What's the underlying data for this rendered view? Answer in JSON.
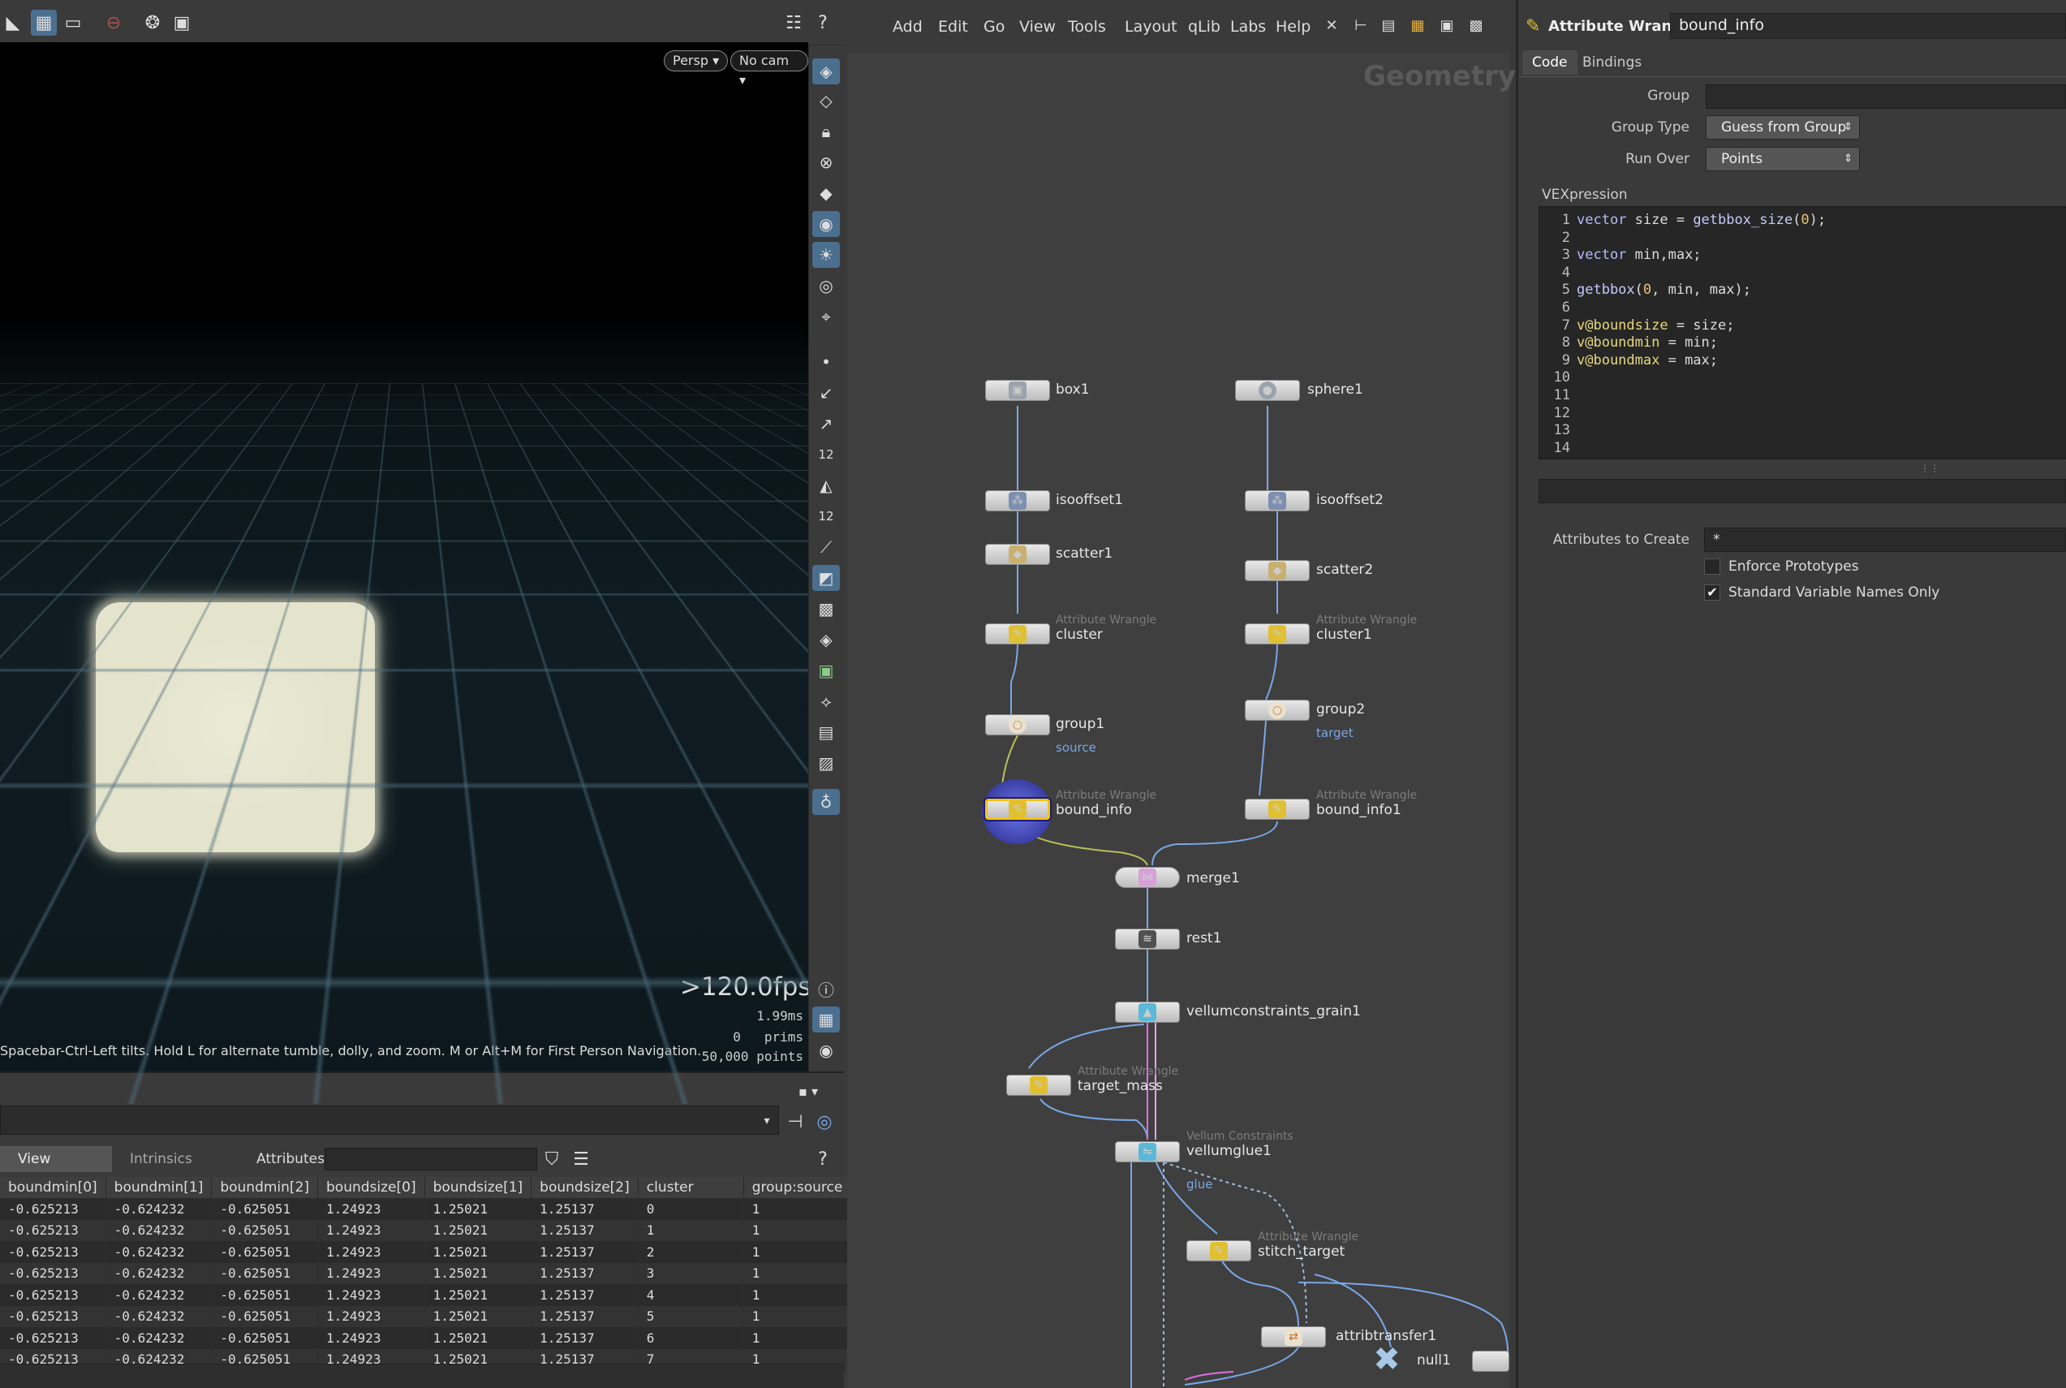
{
  "viewport": {
    "persp_label": "Persp",
    "cam_label": "No cam",
    "fps": ">120.0fps",
    "time": "1.99ms",
    "prims": "0   prims",
    "points": "50,000 points",
    "hint": "Spacebar-Ctrl-Left tilts. Hold L for alternate tumble, dolly, and zoom. M or Alt+M for First Person Navigation."
  },
  "spreadsheet": {
    "view_tab": "View",
    "intrinsics_tab": "Intrinsics",
    "attributes_label": "Attributes:",
    "columns": [
      "boundmin[0]",
      "boundmin[1]",
      "boundmin[2]",
      "boundsize[0]",
      "boundsize[1]",
      "boundsize[2]",
      "cluster",
      "group:source"
    ],
    "rows": [
      [
        "-0.625213",
        "-0.624232",
        "-0.625051",
        "1.24923",
        "1.25021",
        "1.25137",
        "0",
        "1"
      ],
      [
        "-0.625213",
        "-0.624232",
        "-0.625051",
        "1.24923",
        "1.25021",
        "1.25137",
        "1",
        "1"
      ],
      [
        "-0.625213",
        "-0.624232",
        "-0.625051",
        "1.24923",
        "1.25021",
        "1.25137",
        "2",
        "1"
      ],
      [
        "-0.625213",
        "-0.624232",
        "-0.625051",
        "1.24923",
        "1.25021",
        "1.25137",
        "3",
        "1"
      ],
      [
        "-0.625213",
        "-0.624232",
        "-0.625051",
        "1.24923",
        "1.25021",
        "1.25137",
        "4",
        "1"
      ],
      [
        "-0.625213",
        "-0.624232",
        "-0.625051",
        "1.24923",
        "1.25021",
        "1.25137",
        "5",
        "1"
      ],
      [
        "-0.625213",
        "-0.624232",
        "-0.625051",
        "1.24923",
        "1.25021",
        "1.25137",
        "6",
        "1"
      ],
      [
        "-0.625213",
        "-0.624232",
        "-0.625051",
        "1.24923",
        "1.25021",
        "1.25137",
        "7",
        "1"
      ]
    ]
  },
  "network": {
    "menu": [
      "Add",
      "Edit",
      "Go",
      "View",
      "Tools",
      "Layout",
      "qLib",
      "Labs",
      "Help"
    ],
    "context": "Geometry",
    "nodes": {
      "box1": "box1",
      "sphere1": "sphere1",
      "isooffset1": "isooffset1",
      "isooffset2": "isooffset2",
      "scatter1": "scatter1",
      "scatter2": "scatter2",
      "cluster": "cluster",
      "cluster1": "cluster1",
      "group1": "group1",
      "group2": "group2",
      "bound_info": "bound_info",
      "bound_info1": "bound_info1",
      "merge1": "merge1",
      "rest1": "rest1",
      "vellumconstraints_grain1": "vellumconstraints_grain1",
      "target_mass": "target_mass",
      "vellumglue1": "vellumglue1",
      "stitch_target": "stitch_target",
      "attribtransfer1": "attribtransfer1",
      "null1": "null1"
    },
    "type_attribute_wrangle": "Attribute Wrangle",
    "type_vellum_constraints": "Vellum Constraints",
    "flag_source": "source",
    "flag_target": "target",
    "flag_glue": "glue"
  },
  "params": {
    "node_type": "Attribute Wrangle",
    "node_name": "bound_info",
    "tabs": [
      "Code",
      "Bindings"
    ],
    "group_label": "Group",
    "group_value": "",
    "group_type_label": "Group Type",
    "group_type_value": "Guess from Group",
    "run_over_label": "Run Over",
    "run_over_value": "Points",
    "vex_label": "VEXpression",
    "code_lines": [
      "vector size = getbbox_size(0);",
      "",
      "vector min,max;",
      "",
      "getbbox(0, min, max);",
      "",
      "v@boundsize = size;",
      "v@boundmin = min;",
      "v@boundmax = max;",
      "",
      "",
      "",
      "",
      ""
    ],
    "attributes_to_create_label": "Attributes to Create",
    "attributes_to_create_value": "*",
    "enforce_prototypes_label": "Enforce Prototypes",
    "enforce_prototypes": false,
    "standard_names_label": "Standard Variable Names Only",
    "standard_names": true
  },
  "colors": {
    "selected_node": "#f5c400",
    "glue_wire": "#e070e0",
    "wire": "#7aa7e6"
  }
}
